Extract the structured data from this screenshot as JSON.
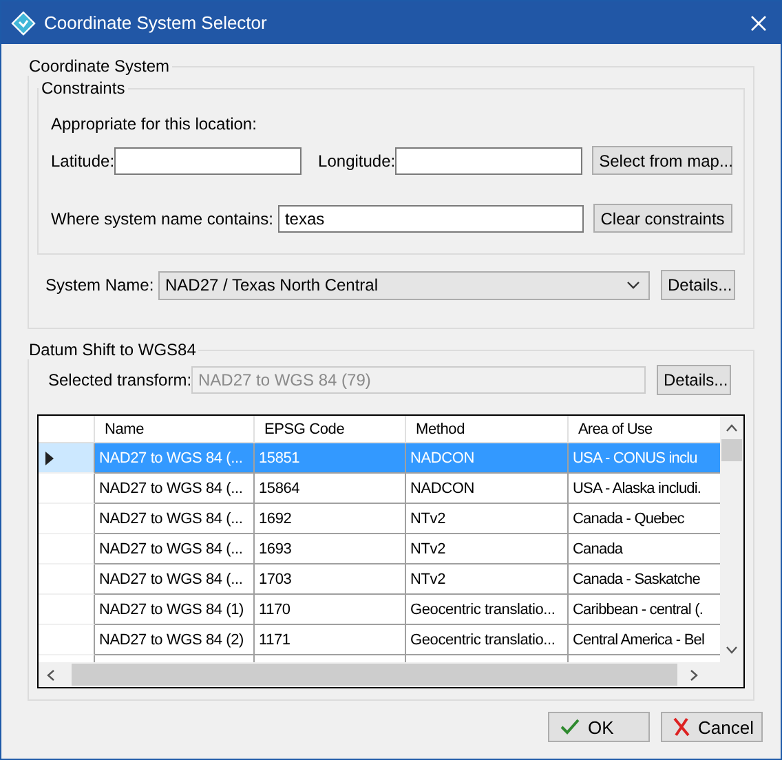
{
  "window": {
    "title": "Coordinate System Selector"
  },
  "coordinate_system": {
    "title": "Coordinate System",
    "constraints": {
      "title": "Constraints",
      "location_label": "Appropriate for this location:",
      "latitude": {
        "label": "Latitude:"
      },
      "longitude": {
        "label": "Longitude:"
      },
      "map_button": "Select from map...",
      "name_filter": {
        "label": "Where system name contains:",
        "value": "texas"
      },
      "clear_button": "Clear constraints"
    },
    "system_name": {
      "label": "System Name:",
      "value": "NAD27 / Texas North Central"
    },
    "details_button": "Details..."
  },
  "datum_shift": {
    "title": "Datum Shift to WGS84",
    "selected_transform": {
      "label": "Selected transform:",
      "value": "NAD27 to WGS 84 (79)",
      "disabled": true
    },
    "details_button": "Details...",
    "table": {
      "columns": [
        "Name",
        "EPSG Code",
        "Method",
        "Area of Use"
      ],
      "rows": [
        {
          "selected": true,
          "cells": [
            "NAD27 to WGS 84 (...",
            "15851",
            "NADCON",
            "USA - CONUS inclu"
          ]
        },
        {
          "selected": false,
          "cells": [
            "NAD27 to WGS 84 (...",
            "15864",
            "NADCON",
            "USA - Alaska includi."
          ]
        },
        {
          "selected": false,
          "cells": [
            "NAD27 to WGS 84 (...",
            "1692",
            "NTv2",
            "Canada - Quebec"
          ]
        },
        {
          "selected": false,
          "cells": [
            "NAD27 to WGS 84 (...",
            "1693",
            "NTv2",
            "Canada"
          ]
        },
        {
          "selected": false,
          "cells": [
            "NAD27 to WGS 84 (...",
            "1703",
            "NTv2",
            "Canada - Saskatche"
          ]
        },
        {
          "selected": false,
          "cells": [
            "NAD27 to WGS 84 (1)",
            "1170",
            "Geocentric translatio...",
            "Caribbean - central (."
          ]
        },
        {
          "selected": false,
          "cells": [
            "NAD27 to WGS 84 (2)",
            "1171",
            "Geocentric translatio...",
            "Central America - Bel"
          ]
        }
      ]
    }
  },
  "buttons": [
    {
      "kind": "ok",
      "label": "OK"
    },
    {
      "kind": "cancel",
      "label": "Cancel"
    }
  ]
}
